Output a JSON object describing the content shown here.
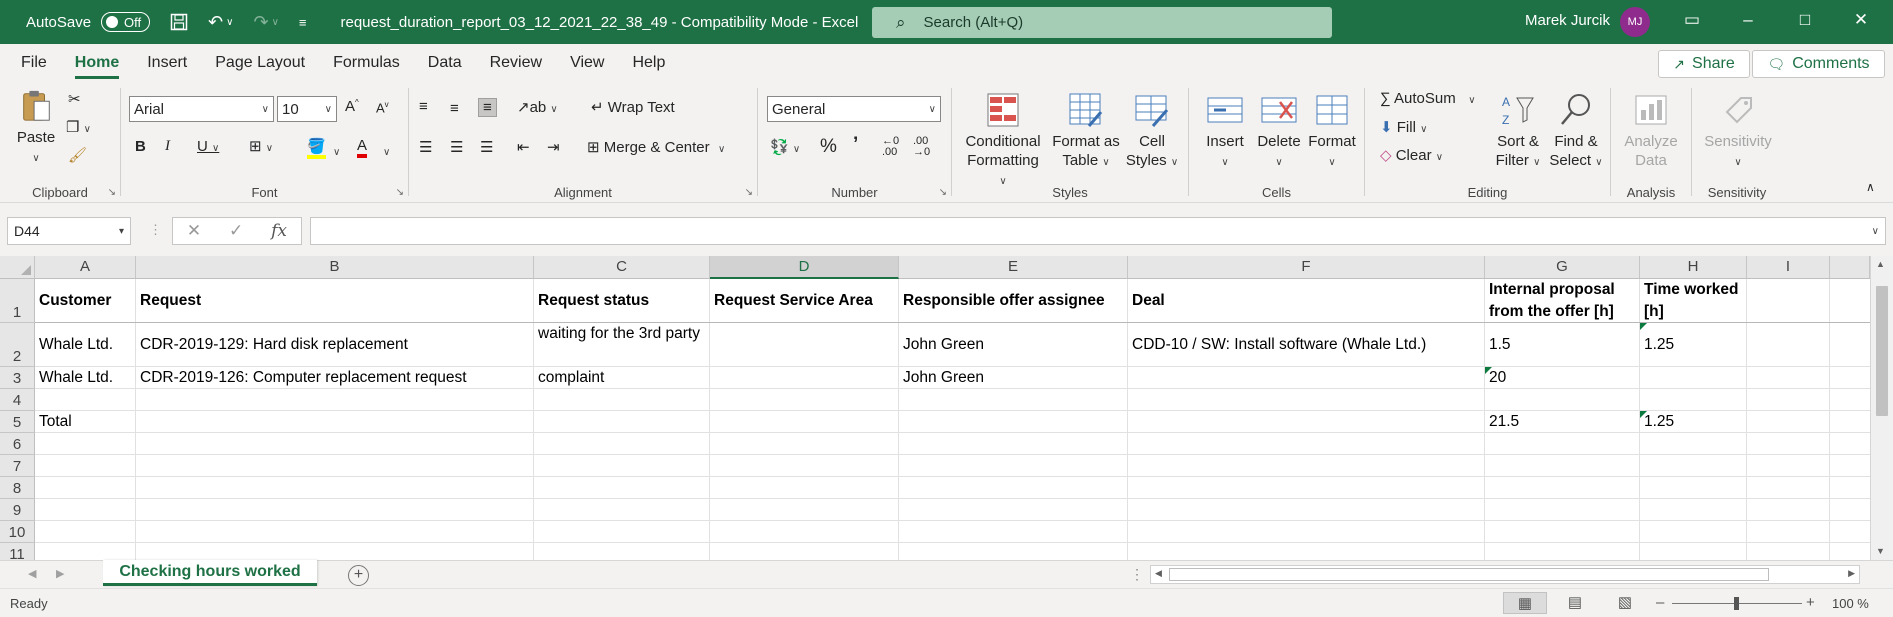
{
  "titlebar": {
    "autosave_label": "AutoSave",
    "autosave_state": "Off",
    "title": "request_duration_report_03_12_2021_22_38_49  -  Compatibility Mode  -  Excel",
    "search_placeholder": "Search (Alt+Q)",
    "user_name": "Marek Jurcik",
    "user_initials": "MJ"
  },
  "menu": {
    "tabs": [
      "File",
      "Home",
      "Insert",
      "Page Layout",
      "Formulas",
      "Data",
      "Review",
      "View",
      "Help"
    ],
    "active": "Home",
    "share_label": "Share",
    "comments_label": "Comments"
  },
  "ribbon": {
    "clipboard": {
      "label": "Clipboard",
      "paste": "Paste"
    },
    "font": {
      "label": "Font",
      "name": "Arial",
      "size": "10"
    },
    "alignment": {
      "label": "Alignment",
      "wrap_text": "Wrap Text",
      "merge_center": "Merge & Center"
    },
    "number": {
      "label": "Number",
      "format": "General"
    },
    "styles": {
      "label": "Styles",
      "conditional_1": "Conditional",
      "conditional_2": "Formatting",
      "format_table_1": "Format as",
      "format_table_2": "Table",
      "cell_styles_1": "Cell",
      "cell_styles_2": "Styles"
    },
    "cells": {
      "label": "Cells",
      "insert": "Insert",
      "delete": "Delete",
      "format": "Format"
    },
    "editing": {
      "label": "Editing",
      "autosum": "AutoSum",
      "fill": "Fill",
      "clear": "Clear",
      "sort_1": "Sort &",
      "sort_2": "Filter",
      "find_1": "Find &",
      "find_2": "Select"
    },
    "analysis": {
      "label": "Analysis",
      "analyze_1": "Analyze",
      "analyze_2": "Data"
    },
    "sensitivity": {
      "label": "Sensitivity",
      "button": "Sensitivity"
    }
  },
  "formula_bar": {
    "name_box": "D44",
    "fx": "fx",
    "content": ""
  },
  "sheet": {
    "columns": [
      "A",
      "B",
      "C",
      "D",
      "E",
      "F",
      "G",
      "H",
      "I"
    ],
    "selected_column": "D",
    "row_numbers": [
      "1",
      "2",
      "3",
      "4",
      "5",
      "6",
      "7",
      "8",
      "9",
      "10",
      "11"
    ],
    "header": {
      "a": "Customer",
      "b": "Request",
      "c": "Request status",
      "d": "Request Service Area",
      "e": "Responsible offer assignee",
      "f": "Deal",
      "g": "Internal proposal from the offer [h]",
      "h": "Time worked [h]"
    },
    "row2": {
      "a": "Whale Ltd.",
      "b": "CDR-2019-129: Hard disk replacement",
      "c": "waiting for the 3rd party",
      "e": "John Green",
      "f": "CDD-10 / SW: Install software (Whale Ltd.)",
      "g": "1.5",
      "h": "1.25"
    },
    "row3": {
      "a": "Whale Ltd.",
      "b": "CDR-2019-126: Computer replacement request",
      "c": "complaint",
      "e": "John Green",
      "g": "20"
    },
    "row5": {
      "a": "Total",
      "g": "21.5",
      "h": "1.25"
    },
    "tab_name": "Checking hours worked"
  },
  "status": {
    "ready": "Ready",
    "zoom": "100 %"
  },
  "colors": {
    "accent": "#1e7145",
    "avatar": "#8e2b8c"
  }
}
